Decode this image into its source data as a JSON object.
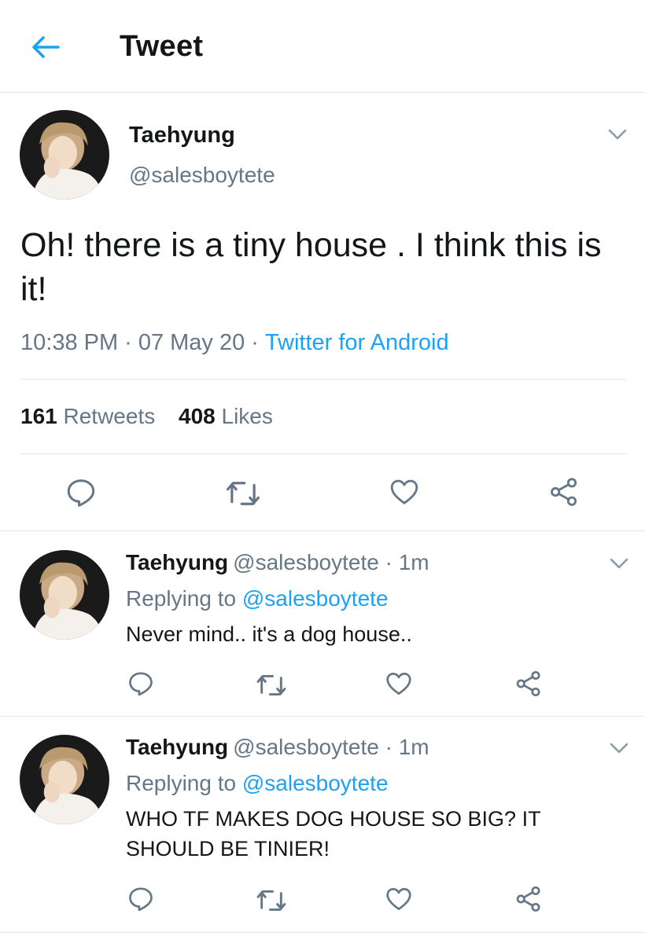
{
  "header": {
    "title": "Tweet",
    "back_icon": "arrow-left-icon",
    "accent_color": "#1da1f2"
  },
  "main_tweet": {
    "display_name": "Taehyung",
    "handle": "@salesboytete",
    "text": "Oh! there is a tiny house . I think this is it!",
    "time": "10:38 PM",
    "dot1": "·",
    "date": "07 May 20",
    "dot2": "·",
    "source": "Twitter for Android",
    "retweets_count": "161",
    "retweets_label": "Retweets",
    "likes_count": "408",
    "likes_label": "Likes",
    "actions": [
      "reply-icon",
      "retweet-icon",
      "like-icon",
      "share-icon"
    ]
  },
  "replies": [
    {
      "display_name": "Taehyung",
      "handle": "@salesboytete",
      "dot": "·",
      "time": "1m",
      "replying_label": "Replying to",
      "replying_to": "@salesboytete",
      "text": "Never mind.. it's a dog house.."
    },
    {
      "display_name": "Taehyung",
      "handle": "@salesboytete",
      "dot": "·",
      "time": "1m",
      "replying_label": "Replying to",
      "replying_to": "@salesboytete",
      "text": "WHO TF MAKES DOG HOUSE SO BIG? IT SHOULD BE TINIER!"
    }
  ]
}
